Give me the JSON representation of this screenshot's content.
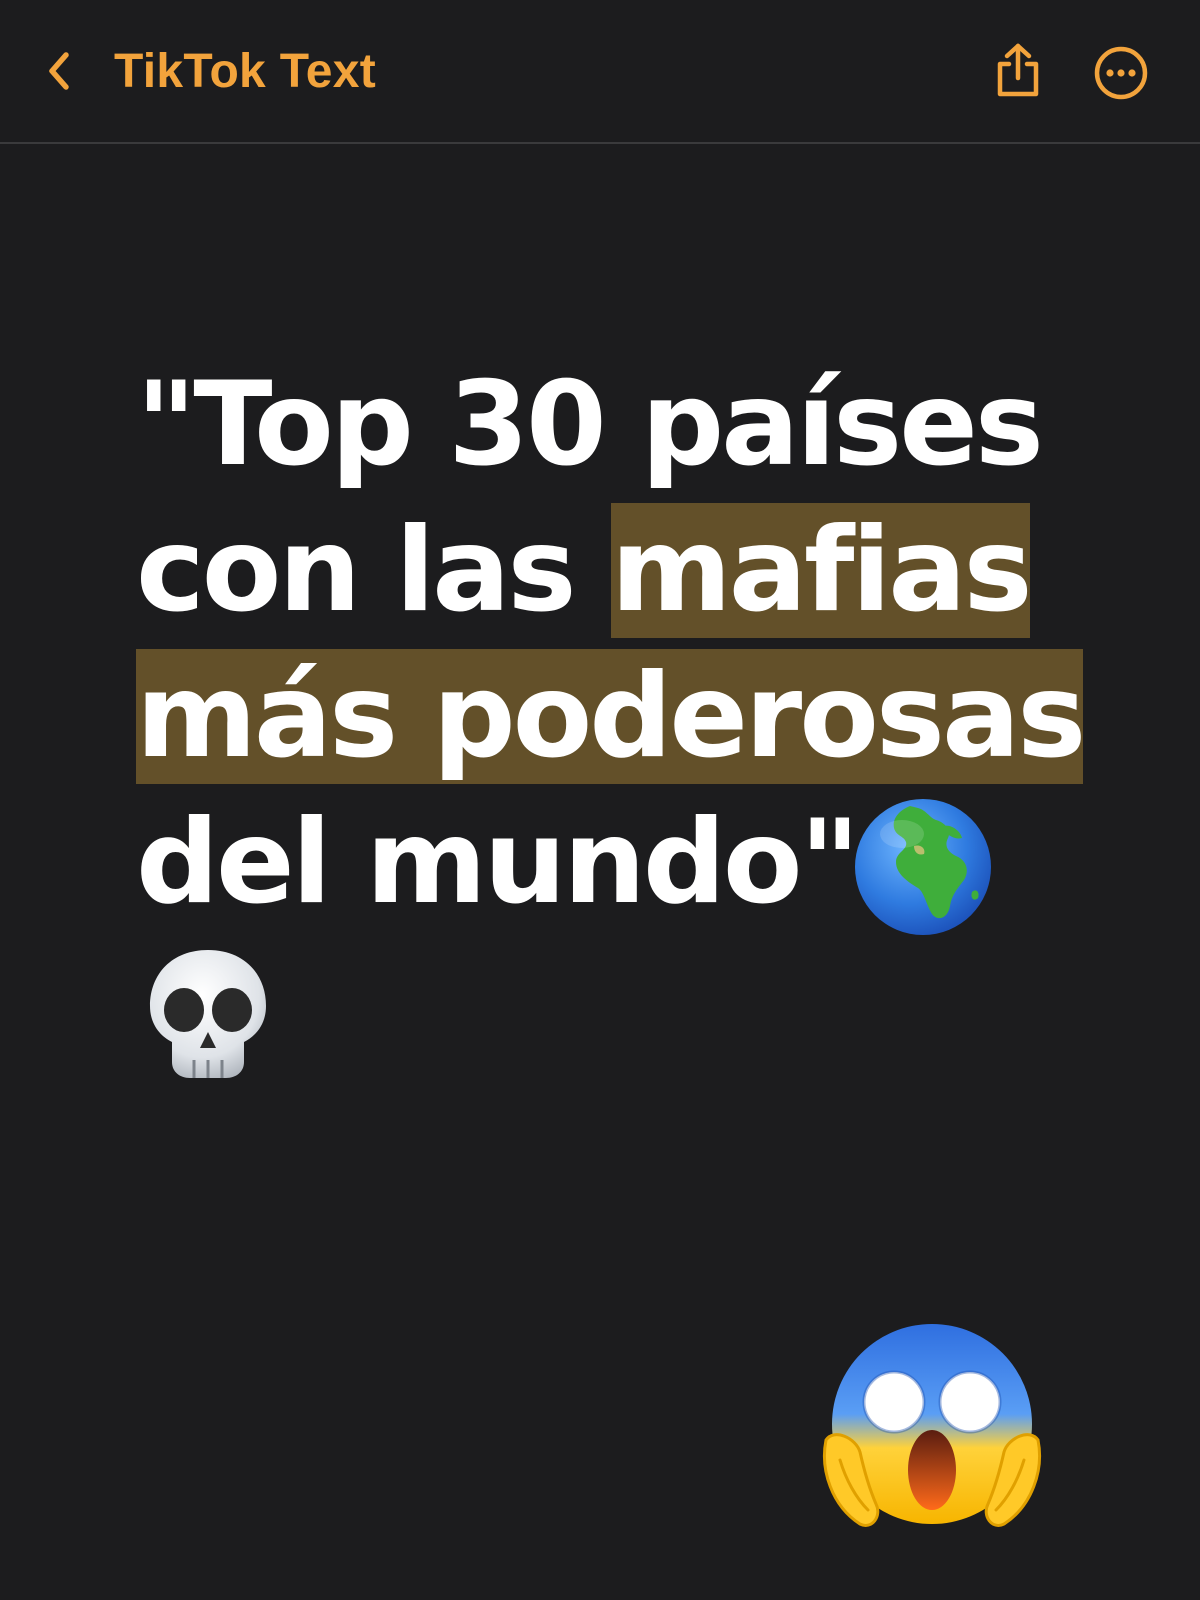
{
  "header": {
    "back_label": "TikTok Text",
    "back_icon": "chevron-left-icon",
    "share_icon": "share-icon",
    "more_icon": "ellipsis-circle-icon"
  },
  "note": {
    "lines": [
      "\"Top 30 países",
      "con las ",
      "mafias",
      "más poderosas",
      "del mundo\""
    ],
    "emojis": [
      "globe-emoji",
      "skull-emoji",
      "screaming-face-emoji"
    ]
  },
  "colors": {
    "accent": "#f2a33c",
    "background": "#1c1c1e",
    "highlight": "#635029",
    "text": "#ffffff"
  }
}
